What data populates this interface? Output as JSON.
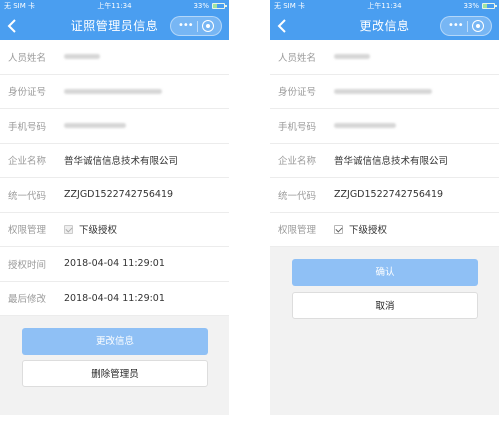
{
  "colors": {
    "header": "#4a9ef0",
    "primary_button": "#8fc0f5",
    "page_background": "#f2f2f2"
  },
  "status": {
    "carrier": "无 SIM 卡",
    "time": "上午11:34",
    "battery": "33%",
    "battery_level": 0.33
  },
  "left": {
    "title": "证照管理员信息",
    "fields": [
      {
        "label": "人员姓名"
      },
      {
        "label": "身份证号"
      },
      {
        "label": "手机号码"
      },
      {
        "label": "企业名称",
        "value": "普华诚信信息技术有限公司"
      },
      {
        "label": "统一代码",
        "value": "ZZJGD1522742756419"
      },
      {
        "label": "权限管理",
        "value": "下级授权"
      },
      {
        "label": "授权时间",
        "value": "2018-04-04 11:29:01"
      },
      {
        "label": "最后修改",
        "value": "2018-04-04 11:29:01"
      }
    ],
    "edit_button": "更改信息",
    "delete_button": "删除管理员"
  },
  "right": {
    "title": "更改信息",
    "fields": [
      {
        "label": "人员姓名"
      },
      {
        "label": "身份证号"
      },
      {
        "label": "手机号码"
      },
      {
        "label": "企业名称",
        "value": "普华诚信信息技术有限公司"
      },
      {
        "label": "统一代码",
        "value": "ZZJGD1522742756419"
      },
      {
        "label": "权限管理",
        "value": "下级授权"
      }
    ],
    "confirm_button": "确认",
    "cancel_button": "取消"
  }
}
